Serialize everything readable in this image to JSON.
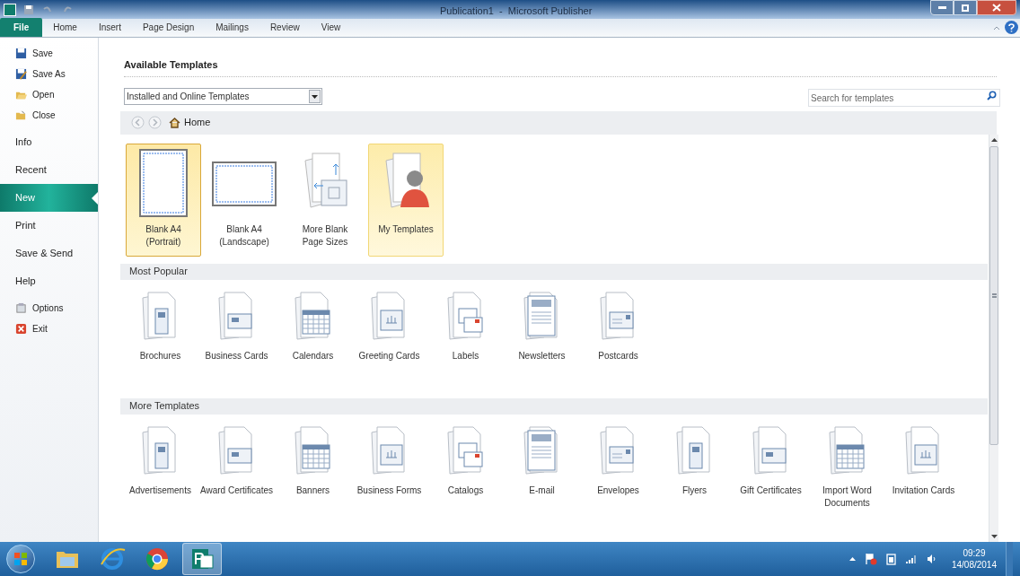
{
  "window": {
    "title": "Publication1  -  Microsoft Publisher"
  },
  "ribbon_tabs": [
    {
      "label": "File",
      "selected": true
    },
    {
      "label": "Home",
      "selected": false
    },
    {
      "label": "Insert",
      "selected": false
    },
    {
      "label": "Page Design",
      "selected": false
    },
    {
      "label": "Mailings",
      "selected": false
    },
    {
      "label": "Review",
      "selected": false
    },
    {
      "label": "View",
      "selected": false
    }
  ],
  "sidebar": {
    "items": [
      {
        "kind": "command",
        "label": "Save",
        "selected": false
      },
      {
        "kind": "command",
        "label": "Save As",
        "selected": false
      },
      {
        "kind": "command",
        "label": "Open",
        "selected": false
      },
      {
        "kind": "command",
        "label": "Close",
        "selected": false
      },
      {
        "kind": "page",
        "label": "Info",
        "selected": false
      },
      {
        "kind": "page",
        "label": "Recent",
        "selected": false
      },
      {
        "kind": "page",
        "label": "New",
        "selected": true
      },
      {
        "kind": "page",
        "label": "Print",
        "selected": false
      },
      {
        "kind": "page",
        "label": "Save & Send",
        "selected": false
      },
      {
        "kind": "page",
        "label": "Help",
        "selected": false
      },
      {
        "kind": "command",
        "label": "Options",
        "selected": false
      },
      {
        "kind": "command",
        "label": "Exit",
        "selected": false
      }
    ]
  },
  "main": {
    "heading": "Available Templates",
    "source_dropdown": {
      "value": "Installed and Online Templates"
    },
    "search": {
      "placeholder": "Search for templates"
    },
    "breadcrumb": "Home",
    "featured": [
      {
        "kind": "portrait",
        "label": "Blank A4 (Portrait)",
        "selected": true,
        "hovered": false
      },
      {
        "kind": "landscape",
        "label": "Blank A4 (Landscape)",
        "selected": false,
        "hovered": false
      },
      {
        "kind": "sizes",
        "label": "More Blank Page Sizes",
        "selected": false,
        "hovered": false
      },
      {
        "kind": "folder",
        "label": "My Templates",
        "selected": false,
        "hovered": true
      }
    ],
    "sections": [
      {
        "title": "Most Popular",
        "items": [
          "Brochures",
          "Business Cards",
          "Calendars",
          "Greeting Cards",
          "Labels",
          "Newsletters",
          "Postcards"
        ]
      },
      {
        "title": "More Templates",
        "items": [
          "Advertisements",
          "Award Certificates",
          "Banners",
          "Business Forms",
          "Catalogs",
          "E-mail",
          "Envelopes",
          "Flyers",
          "Gift Certificates",
          "Import Word Documents",
          "Invitation Cards"
        ]
      }
    ]
  },
  "taskbar": {
    "apps": [
      {
        "kind": "explorer",
        "selected": false
      },
      {
        "kind": "ie",
        "selected": false
      },
      {
        "kind": "chrome",
        "selected": false
      },
      {
        "kind": "publisher",
        "selected": true
      }
    ],
    "time": "09:29",
    "date": "14/08/2014"
  }
}
